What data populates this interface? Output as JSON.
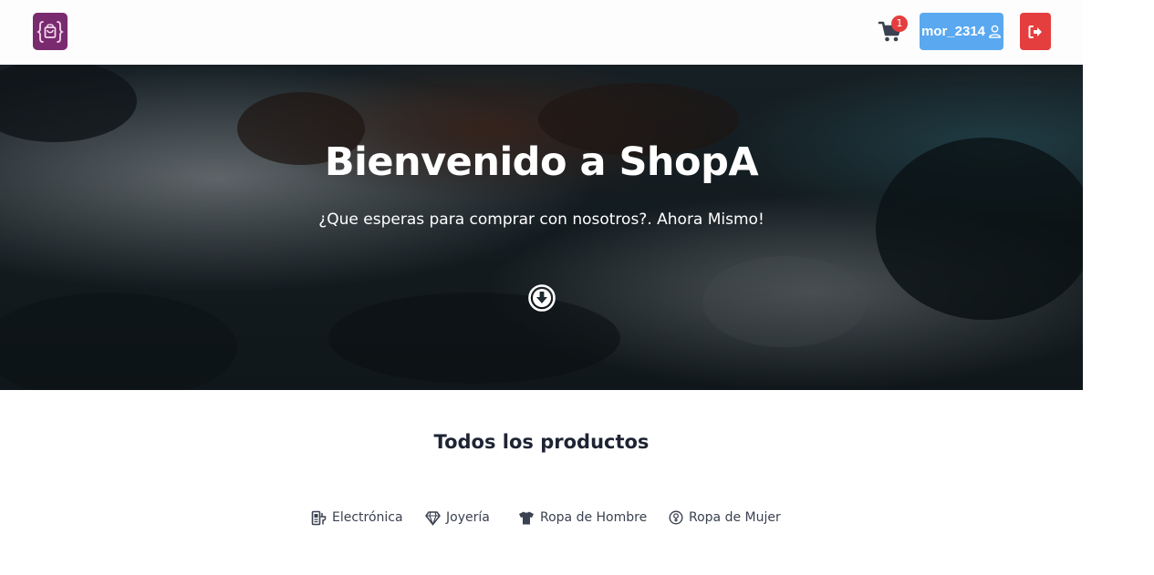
{
  "header": {
    "logo_icon": "shopping-bag-braces-logo",
    "cart_icon": "cart-icon",
    "cart_count": "1",
    "user_label": "mor_2314",
    "user_icon": "user-icon",
    "logout_icon": "sign-out-icon"
  },
  "hero": {
    "title": "Bienvenido a ShopA",
    "subtitle": "¿Que esperas para comprar con nosotros?. Ahora Mismo!",
    "scroll_icon": "arrow-down-circle-icon"
  },
  "products": {
    "title": "Todos los productos",
    "categories": [
      {
        "label": "Electrónica",
        "icon": "electronics-icon"
      },
      {
        "label": "Joyería",
        "icon": "diamond-icon"
      },
      {
        "label": "Ropa de Hombre",
        "icon": "tshirt-icon"
      },
      {
        "label": "Ropa de Mujer",
        "icon": "female-icon"
      }
    ]
  },
  "colors": {
    "logo_bg": "#7a2a6e",
    "user_button": "#5aa8f0",
    "logout_button": "#e53e3e",
    "badge": "#e53e3e",
    "text_dark": "#1f2433"
  }
}
